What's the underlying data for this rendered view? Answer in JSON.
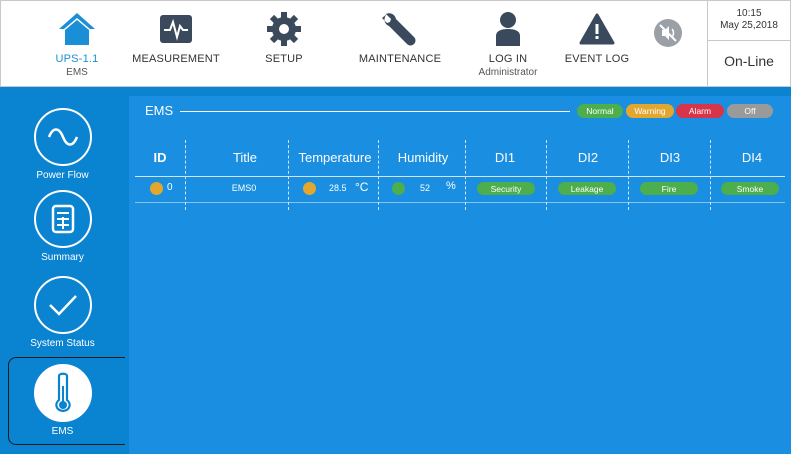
{
  "header": {
    "home": {
      "label": "UPS-1.1",
      "sub": "EMS"
    },
    "measurement": {
      "label": "MEASUREMENT"
    },
    "setup": {
      "label": "SETUP"
    },
    "maintenance": {
      "label": "MAINTENANCE"
    },
    "login": {
      "label": "LOG IN",
      "sub": "Administrator"
    },
    "event_log": {
      "label": "EVENT LOG"
    },
    "clock": {
      "time": "10:15",
      "date": "May 25,2018"
    },
    "status": "On-Line"
  },
  "sidebar": {
    "items": [
      {
        "label": "Power Flow",
        "icon": "power-flow-icon"
      },
      {
        "label": "Summary",
        "icon": "summary-icon"
      },
      {
        "label": "System Status",
        "icon": "check-icon"
      },
      {
        "label": "EMS",
        "icon": "thermometer-icon",
        "selected": true
      }
    ]
  },
  "main": {
    "title": "EMS",
    "legend": {
      "normal": "Normal",
      "warning": "Warning",
      "alarm": "Alarm",
      "off": "Off"
    },
    "columns": [
      "ID",
      "Title",
      "Temperature",
      "Humidity",
      "DI1",
      "DI2",
      "DI3",
      "DI4"
    ],
    "rows": [
      {
        "id": "0",
        "title": "EMS0",
        "temperature": "28.5",
        "temperature_unit": "°C",
        "humidity": "52",
        "humidity_unit": "%",
        "di1": "Security",
        "di2": "Leakage",
        "di3": "Fire",
        "di4": "Smoke"
      }
    ]
  },
  "colors": {
    "primary_blue": "#0a83d0",
    "panel_blue": "#1a8ee0",
    "normal": "#4cae4c",
    "warning": "#e3a72f",
    "alarm": "#d9354a",
    "off": "#9a9a9a"
  }
}
